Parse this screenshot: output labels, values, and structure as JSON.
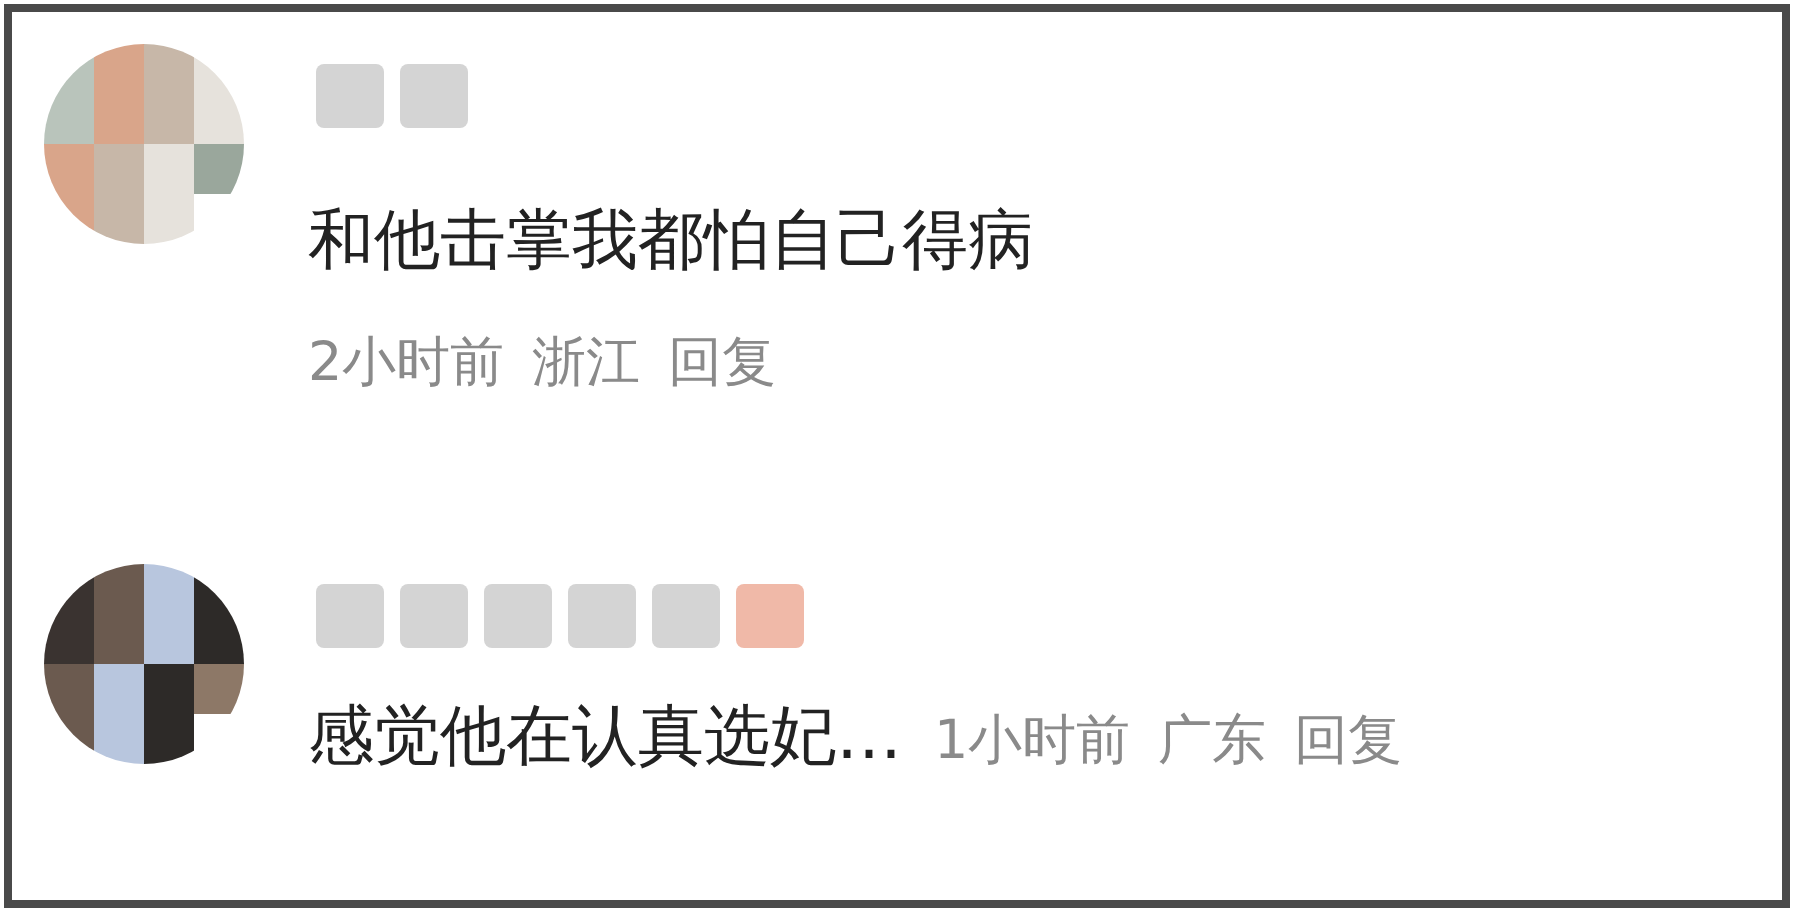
{
  "comments": [
    {
      "kind": "stacked",
      "text": "和他击掌我都怕自己得病",
      "time": "2小时前",
      "region": "浙江",
      "reply": "回复"
    },
    {
      "kind": "inline",
      "text": "感觉他在认真选妃…",
      "time": "1小时前",
      "region": "广东",
      "reply": "回复"
    }
  ]
}
